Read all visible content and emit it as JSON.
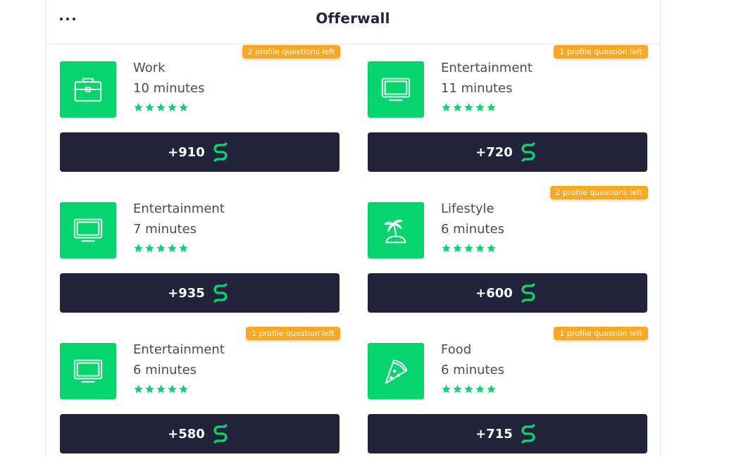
{
  "header": {
    "title": "Offerwall",
    "menu_icon": "more-dots-icon"
  },
  "colors": {
    "accent_green": "#06d56f",
    "button_dark": "#22223a",
    "badge_orange": "#f9a825"
  },
  "offers": [
    {
      "category": "Work",
      "duration": "10 minutes",
      "badge": "2 profile questions left",
      "reward": "+910",
      "icon": "briefcase-icon",
      "rating": 5
    },
    {
      "category": "Entertainment",
      "duration": "11 minutes",
      "badge": "1 profile question left",
      "reward": "+720",
      "icon": "monitor-icon",
      "rating": 5
    },
    {
      "category": "Entertainment",
      "duration": "7 minutes",
      "badge": "",
      "reward": "+935",
      "icon": "monitor-icon",
      "rating": 5
    },
    {
      "category": "Lifestyle",
      "duration": "6 minutes",
      "badge": "2 profile questions left",
      "reward": "+600",
      "icon": "palm-island-icon",
      "rating": 5
    },
    {
      "category": "Entertainment",
      "duration": "6 minutes",
      "badge": "1 profile question left",
      "reward": "+580",
      "icon": "monitor-icon",
      "rating": 5
    },
    {
      "category": "Food",
      "duration": "6 minutes",
      "badge": "1 profile question left",
      "reward": "+715",
      "icon": "pizza-slice-icon",
      "rating": 5
    }
  ]
}
